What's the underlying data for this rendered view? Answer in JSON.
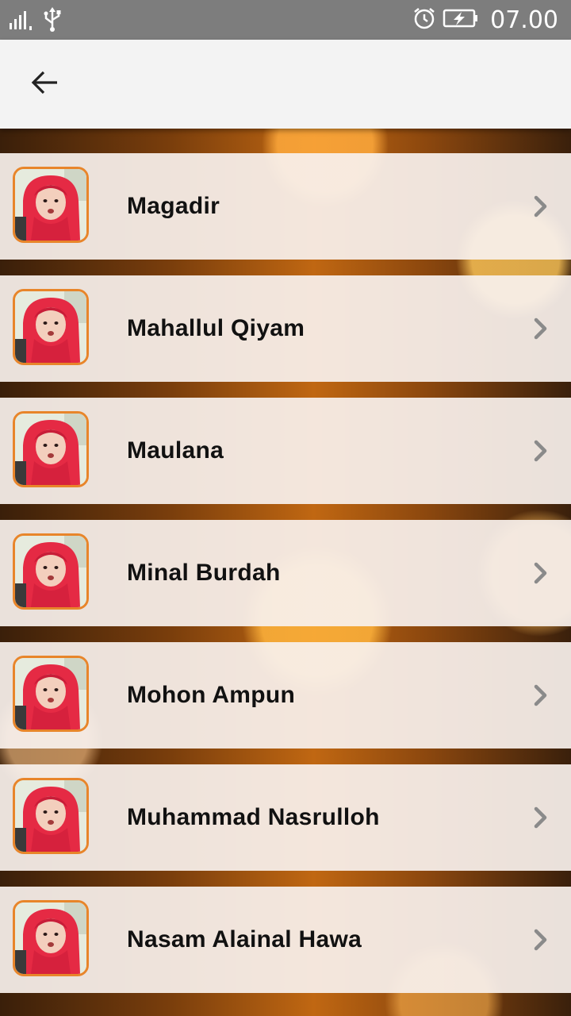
{
  "status_bar": {
    "time": "07.00",
    "icons": [
      "signal-icon",
      "usb-icon",
      "alarm-icon",
      "battery-charging-icon"
    ]
  },
  "app_bar": {
    "back_icon": "arrow-back-icon"
  },
  "songs": [
    {
      "title": "Magadir"
    },
    {
      "title": "Mahallul Qiyam"
    },
    {
      "title": "Maulana"
    },
    {
      "title": "Minal Burdah"
    },
    {
      "title": "Mohon Ampun"
    },
    {
      "title": "Muhammad Nasrulloh"
    },
    {
      "title": "Nasam Alainal Hawa"
    }
  ],
  "colors": {
    "thumb_border": "#e8852a",
    "app_bar_bg": "#f3f3f3",
    "status_bar_bg": "#7d7d7d"
  }
}
